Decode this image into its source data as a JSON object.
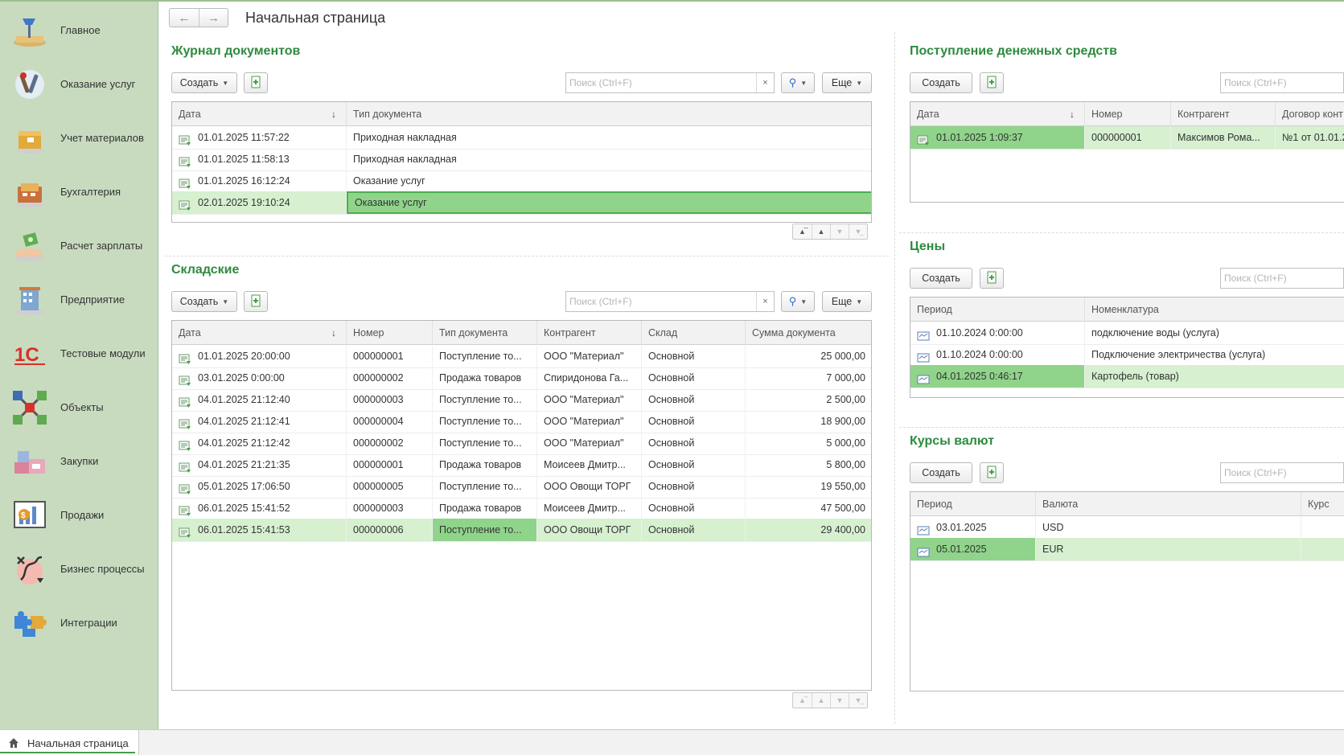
{
  "header": {
    "title": "Начальная страница"
  },
  "sidebar": {
    "items": [
      {
        "label": "Главное",
        "icon": "desk-lamp-icon"
      },
      {
        "label": "Оказание услуг",
        "icon": "tools-icon"
      },
      {
        "label": "Учет материалов",
        "icon": "box-icon"
      },
      {
        "label": "Бухгалтерия",
        "icon": "calculator-icon"
      },
      {
        "label": "Расчет зарплаты",
        "icon": "salary-hand-icon"
      },
      {
        "label": "Предприятие",
        "icon": "building-icon"
      },
      {
        "label": "Тестовые модули",
        "icon": "1c-logo-icon"
      },
      {
        "label": "Объекты",
        "icon": "objects-network-icon"
      },
      {
        "label": "Закупки",
        "icon": "purchases-icon"
      },
      {
        "label": "Продажи",
        "icon": "sales-chart-icon"
      },
      {
        "label": "Бизнес процессы",
        "icon": "business-process-icon"
      },
      {
        "label": "Интеграции",
        "icon": "puzzle-icon"
      }
    ]
  },
  "bottom_tab": {
    "label": "Начальная страница"
  },
  "common": {
    "create": "Создать",
    "more": "Еще",
    "search_placeholder": "Поиск (Ctrl+F)",
    "clear": "×"
  },
  "journal": {
    "title": "Журнал документов",
    "columns": [
      "Дата",
      "Тип документа"
    ],
    "rows": [
      {
        "date": "01.01.2025 11:57:22",
        "type": "Приходная накладная"
      },
      {
        "date": "01.01.2025 11:58:13",
        "type": "Приходная накладная"
      },
      {
        "date": "01.01.2025 16:12:24",
        "type": "Оказание услуг"
      },
      {
        "date": "02.01.2025 19:10:24",
        "type": "Оказание услуг"
      }
    ]
  },
  "warehouse": {
    "title": "Складские",
    "columns": [
      "Дата",
      "Номер",
      "Тип документа",
      "Контрагент",
      "Склад",
      "Сумма документа"
    ],
    "rows": [
      {
        "date": "01.01.2025 20:00:00",
        "number": "000000001",
        "type": "Поступление то...",
        "contractor": "ООО \"Материал\"",
        "warehouse": "Основной",
        "sum": "25 000,00"
      },
      {
        "date": "03.01.2025 0:00:00",
        "number": "000000002",
        "type": "Продажа товаров",
        "contractor": "Спиридонова Га...",
        "warehouse": "Основной",
        "sum": "7 000,00"
      },
      {
        "date": "04.01.2025 21:12:40",
        "number": "000000003",
        "type": "Поступление то...",
        "contractor": "ООО \"Материал\"",
        "warehouse": "Основной",
        "sum": "2 500,00"
      },
      {
        "date": "04.01.2025 21:12:41",
        "number": "000000004",
        "type": "Поступление то...",
        "contractor": "ООО \"Материал\"",
        "warehouse": "Основной",
        "sum": "18 900,00"
      },
      {
        "date": "04.01.2025 21:12:42",
        "number": "000000002",
        "type": "Поступление то...",
        "contractor": "ООО \"Материал\"",
        "warehouse": "Основной",
        "sum": "5 000,00"
      },
      {
        "date": "04.01.2025 21:21:35",
        "number": "000000001",
        "type": "Продажа товаров",
        "contractor": "Моисеев Дмитр...",
        "warehouse": "Основной",
        "sum": "5 800,00"
      },
      {
        "date": "05.01.2025 17:06:50",
        "number": "000000005",
        "type": "Поступление то...",
        "contractor": "ООО Овощи ТОРГ",
        "warehouse": "Основной",
        "sum": "19 550,00"
      },
      {
        "date": "06.01.2025 15:41:52",
        "number": "000000003",
        "type": "Продажа товаров",
        "contractor": "Моисеев Дмитр...",
        "warehouse": "Основной",
        "sum": "47 500,00"
      },
      {
        "date": "06.01.2025 15:41:53",
        "number": "000000006",
        "type": "Поступление то...",
        "contractor": "ООО Овощи ТОРГ",
        "warehouse": "Основной",
        "sum": "29 400,00"
      }
    ]
  },
  "cash": {
    "title": "Поступление денежных средств",
    "columns": [
      "Дата",
      "Номер",
      "Контрагент",
      "Договор конт"
    ],
    "rows": [
      {
        "date": "01.01.2025 1:09:37",
        "number": "000000001",
        "contractor": "Максимов Рома...",
        "contract": "№1 от 01.01.2"
      }
    ]
  },
  "prices": {
    "title": "Цены",
    "columns": [
      "Период",
      "Номенклатура"
    ],
    "rows": [
      {
        "period": "01.10.2024 0:00:00",
        "item": "подключение воды (услуга)"
      },
      {
        "period": "01.10.2024 0:00:00",
        "item": "Подключение электричества (услуга)"
      },
      {
        "period": "04.01.2025 0:46:17",
        "item": "Картофель (товар)"
      }
    ]
  },
  "rates": {
    "title": "Курсы валют",
    "columns": [
      "Период",
      "Валюта",
      "Курс"
    ],
    "rows": [
      {
        "period": "03.01.2025",
        "currency": "USD"
      },
      {
        "period": "05.01.2025",
        "currency": "EUR"
      }
    ]
  },
  "colors": {
    "accent_green": "#2e8b3f",
    "sidebar_bg": "#c8dbbf",
    "selected_row": "#d6f0d0",
    "current_cell": "#8fd48a"
  }
}
